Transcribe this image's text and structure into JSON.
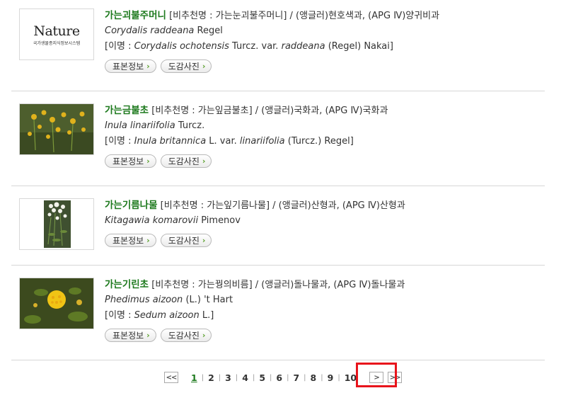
{
  "items": [
    {
      "korean_name": "가는괴불주머니",
      "recommended": "[비추천명 : 가는눈괴불주머니]",
      "family": "/ (앵글러)현호색과, (APG Ⅳ)양귀비과",
      "sci_genus_species": "Corydalis raddeana",
      "sci_author": "Regel",
      "synonym_prefix": "[이명 :",
      "synonym_part1": "Corydalis ochotensis",
      "synonym_mid": "Turcz. var.",
      "synonym_part2": "raddeana",
      "synonym_author": "(Regel) Nakai]",
      "thumb_logo": "Nature",
      "thumb_logo_sub": "국가생물종지식정보시스템",
      "btn_spec": "표본정보",
      "btn_photo": "도감사진"
    },
    {
      "korean_name": "가는금불초",
      "recommended": "[비추천명 : 가는잎금불초]",
      "family": "/ (앵글러)국화과, (APG Ⅳ)국화과",
      "sci_genus_species": "Inula linariifolia",
      "sci_author": "Turcz.",
      "synonym_prefix": "[이명 :",
      "synonym_part1": "Inula britannica",
      "synonym_mid": "L. var.",
      "synonym_part2": "linariifolia",
      "synonym_author": "(Turcz.) Regel]",
      "btn_spec": "표본정보",
      "btn_photo": "도감사진"
    },
    {
      "korean_name": "가는기름나물",
      "recommended": "[비추천명 : 가는잎기름나물]",
      "family": "/ (앵글러)산형과, (APG Ⅳ)산형과",
      "sci_genus_species": "Kitagawia komarovii",
      "sci_author": "Pimenov",
      "btn_spec": "표본정보",
      "btn_photo": "도감사진"
    },
    {
      "korean_name": "가는기린초",
      "recommended": "[비추천명 : 가는꿩의비름]",
      "family": "/ (앵글러)돌나물과, (APG Ⅳ)돌나물과",
      "sci_genus_species": "Phedimus aizoon",
      "sci_author": "(L.) 't Hart",
      "synonym_prefix": "[이명 :",
      "synonym_part1": "Sedum aizoon",
      "synonym_author": "L.]",
      "btn_spec": "표본정보",
      "btn_photo": "도감사진"
    }
  ],
  "pagination": {
    "first": "<<",
    "pages": [
      "1",
      "2",
      "3",
      "4",
      "5",
      "6",
      "7",
      "8",
      "9",
      "10"
    ],
    "current": "1",
    "next": ">",
    "last": ">>"
  },
  "colors": {
    "name_green": "#1e7a1e",
    "highlight": "#e8141b"
  }
}
